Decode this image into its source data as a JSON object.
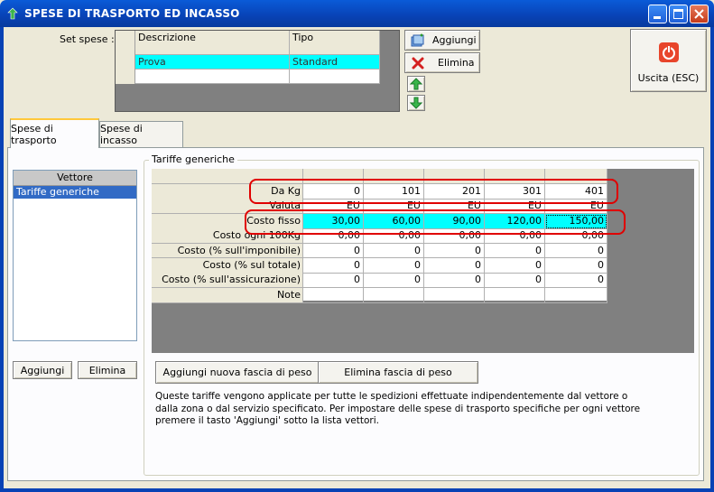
{
  "window": {
    "title": "SPESE DI TRASPORTO ED INCASSO"
  },
  "set_spese": {
    "label": "Set spese :",
    "columns": [
      "Descrizione",
      "Tipo"
    ],
    "rows": [
      [
        "Prova",
        "Standard"
      ]
    ]
  },
  "toolbar": {
    "aggiungi": "Aggiungi",
    "elimina": "Elimina",
    "uscita": "Uscita (ESC)"
  },
  "tabs": [
    "Spese di trasporto",
    "Spese di incasso"
  ],
  "vettore": {
    "header": "Vettore",
    "items": [
      "Tariffe generiche"
    ],
    "aggiungi": "Aggiungi",
    "elimina": "Elimina"
  },
  "tariffe": {
    "group_title": "Tariffe generiche",
    "row_labels": [
      "Da Kg",
      "Valuta",
      "Costo fisso",
      "Costo ogni 100Kg",
      "Costo (% sull'imponibile)",
      "Costo (% sul totale)",
      "Costo (% sull'assicurazione)",
      "Note"
    ],
    "rows": [
      [
        "0",
        "101",
        "201",
        "301",
        "401"
      ],
      [
        "EU",
        "EU",
        "EU",
        "EU",
        "EU"
      ],
      [
        "30,00",
        "60,00",
        "90,00",
        "120,00",
        "150,00"
      ],
      [
        "0,00",
        "0,00",
        "0,00",
        "0,00",
        "0,00"
      ],
      [
        "0",
        "0",
        "0",
        "0",
        "0"
      ],
      [
        "0",
        "0",
        "0",
        "0",
        "0"
      ],
      [
        "0",
        "0",
        "0",
        "0",
        "0"
      ],
      [
        "",
        "",
        "",
        "",
        ""
      ]
    ],
    "add_band": "Aggiungi nuova fascia di peso",
    "delete_band": "Elimina fascia di peso",
    "info": "Queste tariffe vengono applicate per tutte le spedizioni effettuate indipendentemente dal vettore o dalla zona o dal servizio specificato. Per impostare delle spese di trasporto specifiche per ogni vettore premere il tasto 'Aggiungi' sotto la lista vettori."
  },
  "colors": {
    "highlight": "#00ffff",
    "selection": "#316ac5",
    "annotation": "#e00000"
  }
}
